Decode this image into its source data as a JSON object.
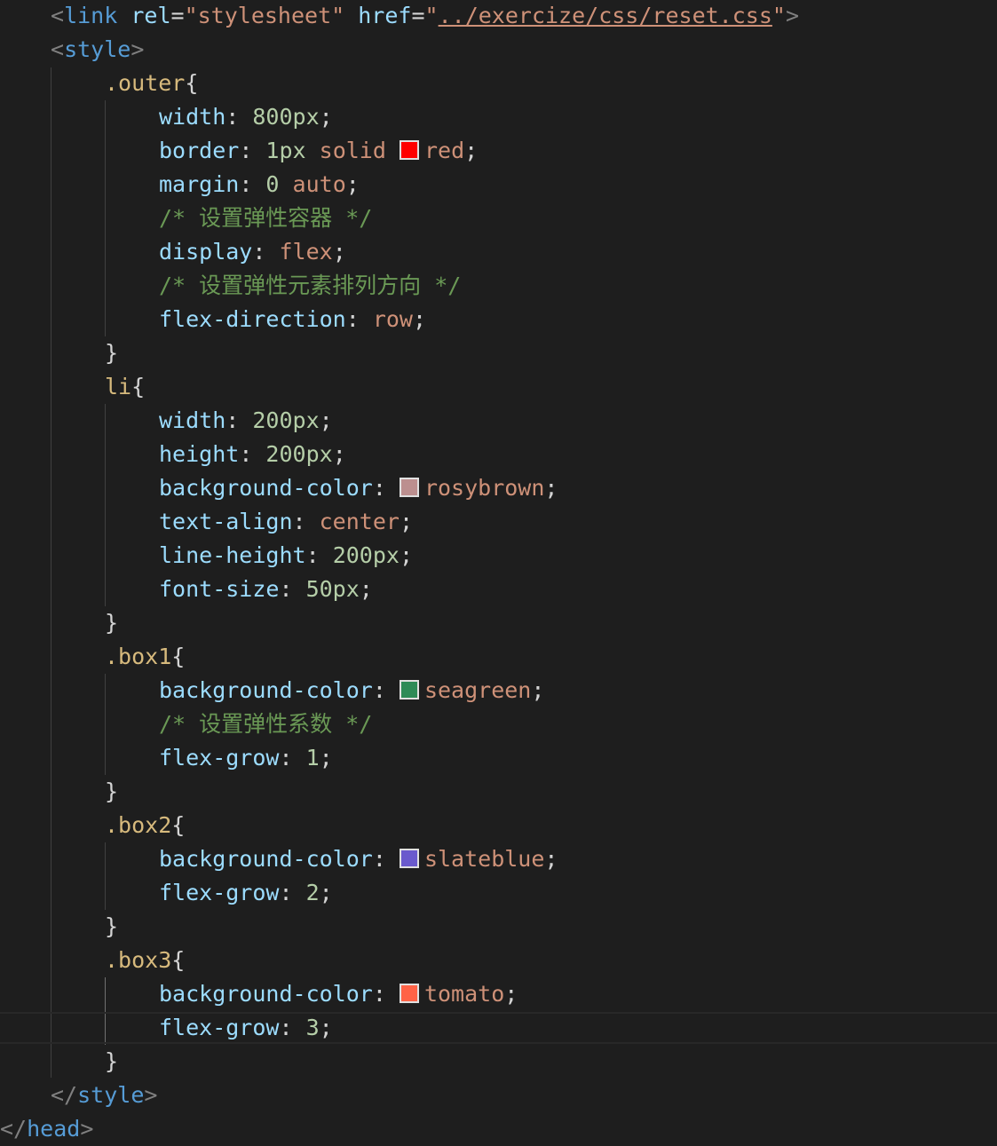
{
  "lines": [
    {
      "indent": 1,
      "tokens": [
        {
          "c": "t-punc",
          "t": "<"
        },
        {
          "c": "t-tag",
          "t": "link"
        },
        {
          "c": "t-plain",
          "t": " "
        },
        {
          "c": "t-attr",
          "t": "rel"
        },
        {
          "c": "t-plain",
          "t": "="
        },
        {
          "c": "t-str",
          "t": "\"stylesheet\""
        },
        {
          "c": "t-plain",
          "t": " "
        },
        {
          "c": "t-attr",
          "t": "href"
        },
        {
          "c": "t-plain",
          "t": "="
        },
        {
          "c": "t-str",
          "t": "\""
        },
        {
          "c": "t-link",
          "t": "../exercize/css/reset.css"
        },
        {
          "c": "t-str",
          "t": "\""
        },
        {
          "c": "t-punc",
          "t": ">"
        }
      ]
    },
    {
      "indent": 1,
      "tokens": [
        {
          "c": "t-punc",
          "t": "<"
        },
        {
          "c": "t-tag",
          "t": "style"
        },
        {
          "c": "t-punc",
          "t": ">"
        }
      ]
    },
    {
      "indent": 2,
      "tokens": [
        {
          "c": "t-sel",
          "t": ".outer"
        },
        {
          "c": "t-plain",
          "t": "{"
        }
      ]
    },
    {
      "indent": 3,
      "tokens": [
        {
          "c": "t-prop",
          "t": "width"
        },
        {
          "c": "t-plain",
          "t": ": "
        },
        {
          "c": "t-num",
          "t": "800px"
        },
        {
          "c": "t-plain",
          "t": ";"
        }
      ]
    },
    {
      "indent": 3,
      "tokens": [
        {
          "c": "t-prop",
          "t": "border"
        },
        {
          "c": "t-plain",
          "t": ": "
        },
        {
          "c": "t-num",
          "t": "1px"
        },
        {
          "c": "t-plain",
          "t": " "
        },
        {
          "c": "t-val",
          "t": "solid"
        },
        {
          "c": "t-plain",
          "t": " "
        },
        {
          "swatch": "#ff0000"
        },
        {
          "c": "t-val",
          "t": "red"
        },
        {
          "c": "t-plain",
          "t": ";"
        }
      ]
    },
    {
      "indent": 3,
      "tokens": [
        {
          "c": "t-prop",
          "t": "margin"
        },
        {
          "c": "t-plain",
          "t": ": "
        },
        {
          "c": "t-num",
          "t": "0"
        },
        {
          "c": "t-plain",
          "t": " "
        },
        {
          "c": "t-val",
          "t": "auto"
        },
        {
          "c": "t-plain",
          "t": ";"
        }
      ]
    },
    {
      "indent": 3,
      "tokens": [
        {
          "c": "t-com",
          "t": "/* 设置弹性容器 */"
        }
      ]
    },
    {
      "indent": 3,
      "tokens": [
        {
          "c": "t-prop",
          "t": "display"
        },
        {
          "c": "t-plain",
          "t": ": "
        },
        {
          "c": "t-val",
          "t": "flex"
        },
        {
          "c": "t-plain",
          "t": ";"
        }
      ]
    },
    {
      "indent": 3,
      "tokens": [
        {
          "c": "t-com",
          "t": "/* 设置弹性元素排列方向 */"
        }
      ]
    },
    {
      "indent": 3,
      "tokens": [
        {
          "c": "t-prop",
          "t": "flex-direction"
        },
        {
          "c": "t-plain",
          "t": ": "
        },
        {
          "c": "t-val",
          "t": "row"
        },
        {
          "c": "t-plain",
          "t": ";"
        }
      ]
    },
    {
      "indent": 2,
      "tokens": [
        {
          "c": "t-plain",
          "t": "}"
        }
      ]
    },
    {
      "indent": 2,
      "tokens": [
        {
          "c": "t-sel",
          "t": "li"
        },
        {
          "c": "t-plain",
          "t": "{"
        }
      ]
    },
    {
      "indent": 3,
      "tokens": [
        {
          "c": "t-prop",
          "t": "width"
        },
        {
          "c": "t-plain",
          "t": ": "
        },
        {
          "c": "t-num",
          "t": "200px"
        },
        {
          "c": "t-plain",
          "t": ";"
        }
      ]
    },
    {
      "indent": 3,
      "tokens": [
        {
          "c": "t-prop",
          "t": "height"
        },
        {
          "c": "t-plain",
          "t": ": "
        },
        {
          "c": "t-num",
          "t": "200px"
        },
        {
          "c": "t-plain",
          "t": ";"
        }
      ]
    },
    {
      "indent": 3,
      "tokens": [
        {
          "c": "t-prop",
          "t": "background-color"
        },
        {
          "c": "t-plain",
          "t": ": "
        },
        {
          "swatch": "#bc8f8f"
        },
        {
          "c": "t-val",
          "t": "rosybrown"
        },
        {
          "c": "t-plain",
          "t": ";"
        }
      ]
    },
    {
      "indent": 3,
      "tokens": [
        {
          "c": "t-prop",
          "t": "text-align"
        },
        {
          "c": "t-plain",
          "t": ": "
        },
        {
          "c": "t-val",
          "t": "center"
        },
        {
          "c": "t-plain",
          "t": ";"
        }
      ]
    },
    {
      "indent": 3,
      "tokens": [
        {
          "c": "t-prop",
          "t": "line-height"
        },
        {
          "c": "t-plain",
          "t": ": "
        },
        {
          "c": "t-num",
          "t": "200px"
        },
        {
          "c": "t-plain",
          "t": ";"
        }
      ]
    },
    {
      "indent": 3,
      "tokens": [
        {
          "c": "t-prop",
          "t": "font-size"
        },
        {
          "c": "t-plain",
          "t": ": "
        },
        {
          "c": "t-num",
          "t": "50px"
        },
        {
          "c": "t-plain",
          "t": ";"
        }
      ]
    },
    {
      "indent": 2,
      "tokens": [
        {
          "c": "t-plain",
          "t": "}"
        }
      ]
    },
    {
      "indent": 2,
      "tokens": [
        {
          "c": "t-sel",
          "t": ".box1"
        },
        {
          "c": "t-plain",
          "t": "{"
        }
      ]
    },
    {
      "indent": 3,
      "tokens": [
        {
          "c": "t-prop",
          "t": "background-color"
        },
        {
          "c": "t-plain",
          "t": ": "
        },
        {
          "swatch": "#2e8b57"
        },
        {
          "c": "t-val",
          "t": "seagreen"
        },
        {
          "c": "t-plain",
          "t": ";"
        }
      ]
    },
    {
      "indent": 3,
      "tokens": [
        {
          "c": "t-com",
          "t": "/* 设置弹性系数 */"
        }
      ]
    },
    {
      "indent": 3,
      "tokens": [
        {
          "c": "t-prop",
          "t": "flex-grow"
        },
        {
          "c": "t-plain",
          "t": ": "
        },
        {
          "c": "t-num",
          "t": "1"
        },
        {
          "c": "t-plain",
          "t": ";"
        }
      ]
    },
    {
      "indent": 2,
      "tokens": [
        {
          "c": "t-plain",
          "t": "}"
        }
      ]
    },
    {
      "indent": 2,
      "tokens": [
        {
          "c": "t-sel",
          "t": ".box2"
        },
        {
          "c": "t-plain",
          "t": "{"
        }
      ]
    },
    {
      "indent": 3,
      "tokens": [
        {
          "c": "t-prop",
          "t": "background-color"
        },
        {
          "c": "t-plain",
          "t": ": "
        },
        {
          "swatch": "#6a5acd"
        },
        {
          "c": "t-val",
          "t": "slateblue"
        },
        {
          "c": "t-plain",
          "t": ";"
        }
      ]
    },
    {
      "indent": 3,
      "tokens": [
        {
          "c": "t-prop",
          "t": "flex-grow"
        },
        {
          "c": "t-plain",
          "t": ": "
        },
        {
          "c": "t-num",
          "t": "2"
        },
        {
          "c": "t-plain",
          "t": ";"
        }
      ]
    },
    {
      "indent": 2,
      "tokens": [
        {
          "c": "t-plain",
          "t": "}"
        }
      ]
    },
    {
      "indent": 2,
      "tokens": [
        {
          "c": "t-sel",
          "t": ".box3"
        },
        {
          "c": "t-plain",
          "t": "{"
        }
      ]
    },
    {
      "indent": 3,
      "tokens": [
        {
          "c": "t-prop",
          "t": "background-color"
        },
        {
          "c": "t-plain",
          "t": ": "
        },
        {
          "swatch": "#ff6347"
        },
        {
          "c": "t-val",
          "t": "tomato"
        },
        {
          "c": "t-plain",
          "t": ";"
        }
      ]
    },
    {
      "indent": 3,
      "tokens": [
        {
          "c": "t-prop",
          "t": "flex-grow"
        },
        {
          "c": "t-plain",
          "t": ": "
        },
        {
          "c": "t-num",
          "t": "3"
        },
        {
          "c": "t-plain",
          "t": ";"
        }
      ],
      "current": true
    },
    {
      "indent": 2,
      "tokens": [
        {
          "c": "t-plain",
          "t": "}"
        }
      ]
    },
    {
      "indent": 1,
      "tokens": [
        {
          "c": "t-punc",
          "t": "</"
        },
        {
          "c": "t-tag",
          "t": "style"
        },
        {
          "c": "t-punc",
          "t": ">"
        }
      ]
    },
    {
      "indent": 0,
      "tokens": [
        {
          "c": "t-punc",
          "t": "</"
        },
        {
          "c": "t-tag",
          "t": "head"
        },
        {
          "c": "t-punc",
          "t": ">"
        }
      ]
    }
  ]
}
